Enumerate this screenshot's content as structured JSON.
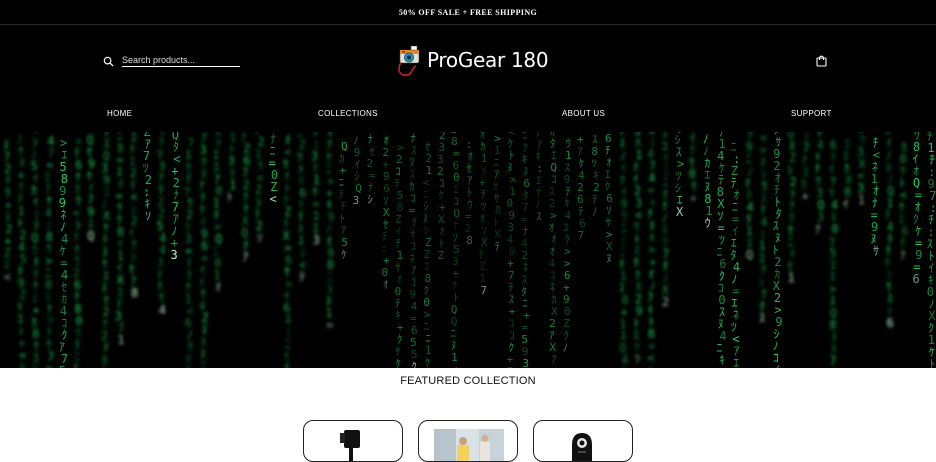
{
  "announcement": "50% OFF SALE + FREE SHIPPING",
  "search": {
    "placeholder": "Search products..."
  },
  "brand": {
    "name": "ProGear 180"
  },
  "nav": {
    "home": "HOME",
    "collections": "COLLECTIONS",
    "about": "ABOUT US",
    "support": "SUPPORT"
  },
  "hero": {
    "theme": "green digital rain"
  },
  "featured": {
    "title": "FEATURED COLLECTION"
  },
  "products": [
    {
      "icon": "phone-gimbal-icon"
    },
    {
      "icon": "product-photo-icon"
    },
    {
      "icon": "webcam-icon"
    }
  ],
  "colors": {
    "header_bg": "#000000",
    "matrix_green": "#1fd15a",
    "page_bg": "#ffffff"
  }
}
